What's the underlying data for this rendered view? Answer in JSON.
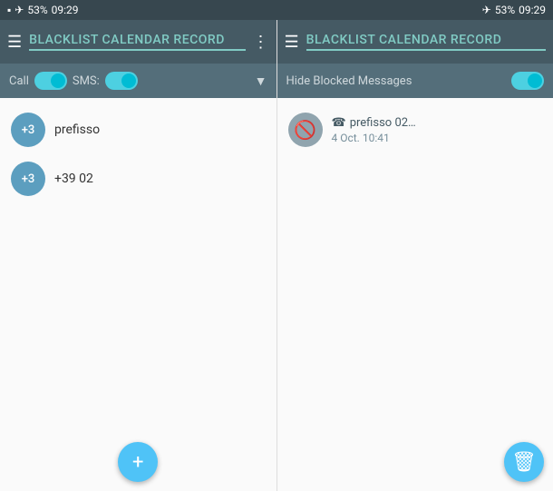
{
  "statusBar": {
    "left": {
      "icon": "▲",
      "battery": "53%",
      "time": "09:29"
    },
    "right": {
      "icon": "▲",
      "battery": "53%",
      "time": "09:29"
    }
  },
  "panels": {
    "left": {
      "appBar": {
        "menuIcon": "☰",
        "title": "BLACKLIST CALENDAR RECORD",
        "moreIcon": "⋮"
      },
      "filterBar": {
        "callLabel": "Call",
        "smsLabel": "SMS:",
        "dropdownArrow": "▼"
      },
      "listItems": [
        {
          "avatar": "+3",
          "text": "prefisso"
        },
        {
          "avatar": "+3",
          "text": "+39 02"
        }
      ],
      "fab": {
        "label": "+"
      }
    },
    "right": {
      "appBar": {
        "menuIcon": "☰",
        "title": "BLACKLIST CALENDAR RECORD",
        "moreIcon": ""
      },
      "filterBar": {
        "hideLabel": "Hide Blocked Messages"
      },
      "listItems": [
        {
          "blockedIcon": "🚫",
          "phone": "☎",
          "number": "prefisso 02…",
          "date": "4 Oct. 10:41"
        }
      ],
      "fab": {
        "label": "🗑"
      }
    }
  }
}
